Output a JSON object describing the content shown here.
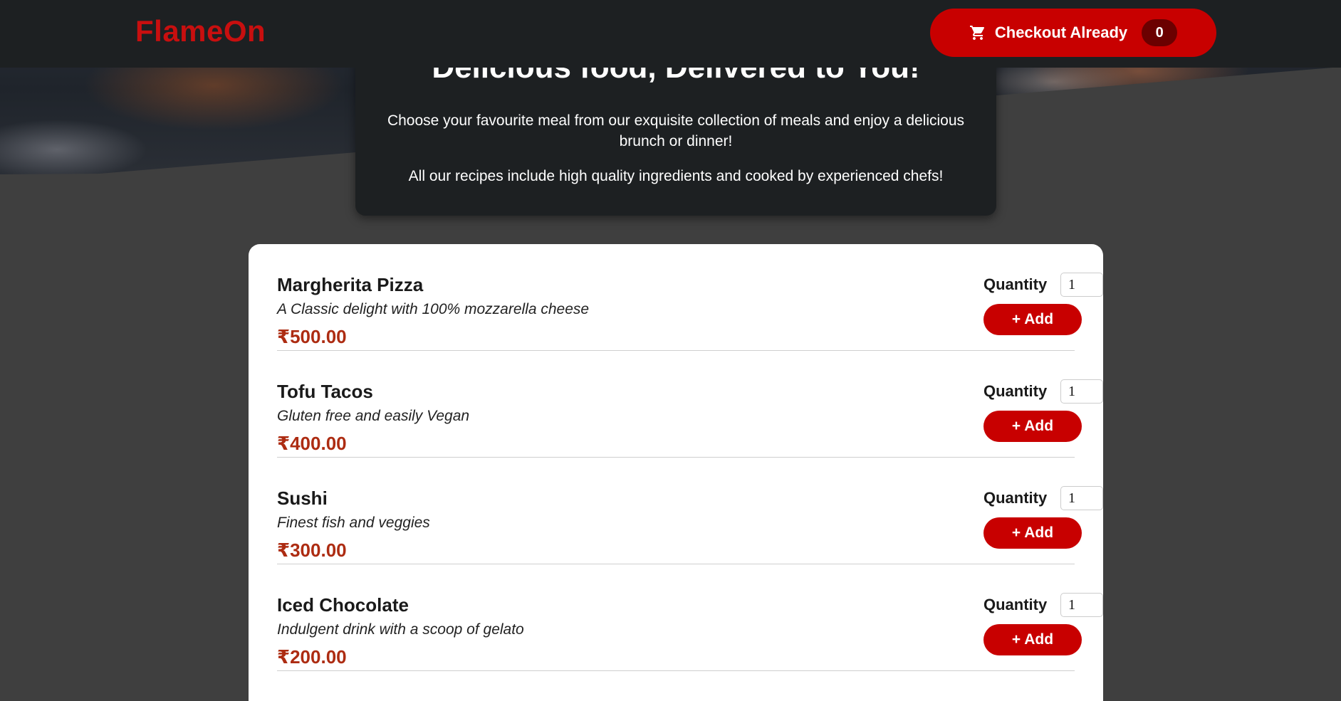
{
  "header": {
    "brand": "FlameOn",
    "cart_label": "Checkout Already",
    "cart_count": "0"
  },
  "summary": {
    "title": "Delicious food, Delivered to You!",
    "p1": "Choose your favourite meal from our exquisite collection of meals and enjoy a delicious brunch or dinner!",
    "p2": "All our recipes include high quality ingredients and cooked by experienced chefs!"
  },
  "meals": [
    {
      "name": "Margherita Pizza",
      "description": "A Classic delight with 100% mozzarella cheese",
      "price": "₹500.00",
      "quantity_label": "Quantity",
      "quantity": "1",
      "add_label": "+ Add"
    },
    {
      "name": "Tofu Tacos",
      "description": "Gluten free and easily Vegan",
      "price": "₹400.00",
      "quantity_label": "Quantity",
      "quantity": "1",
      "add_label": "+ Add"
    },
    {
      "name": "Sushi",
      "description": "Finest fish and veggies",
      "price": "₹300.00",
      "quantity_label": "Quantity",
      "quantity": "1",
      "add_label": "+ Add"
    },
    {
      "name": "Iced Chocolate",
      "description": "Indulgent drink with a scoop of gelato",
      "price": "₹200.00",
      "quantity_label": "Quantity",
      "quantity": "1",
      "add_label": "+ Add"
    }
  ],
  "colors": {
    "brand": "#c80f0f",
    "accent": "#c80000",
    "price": "#ad2c12",
    "header_bg": "#1d2022",
    "page_bg": "#3f3f3f"
  },
  "icons": {
    "cart": "cart-icon"
  }
}
